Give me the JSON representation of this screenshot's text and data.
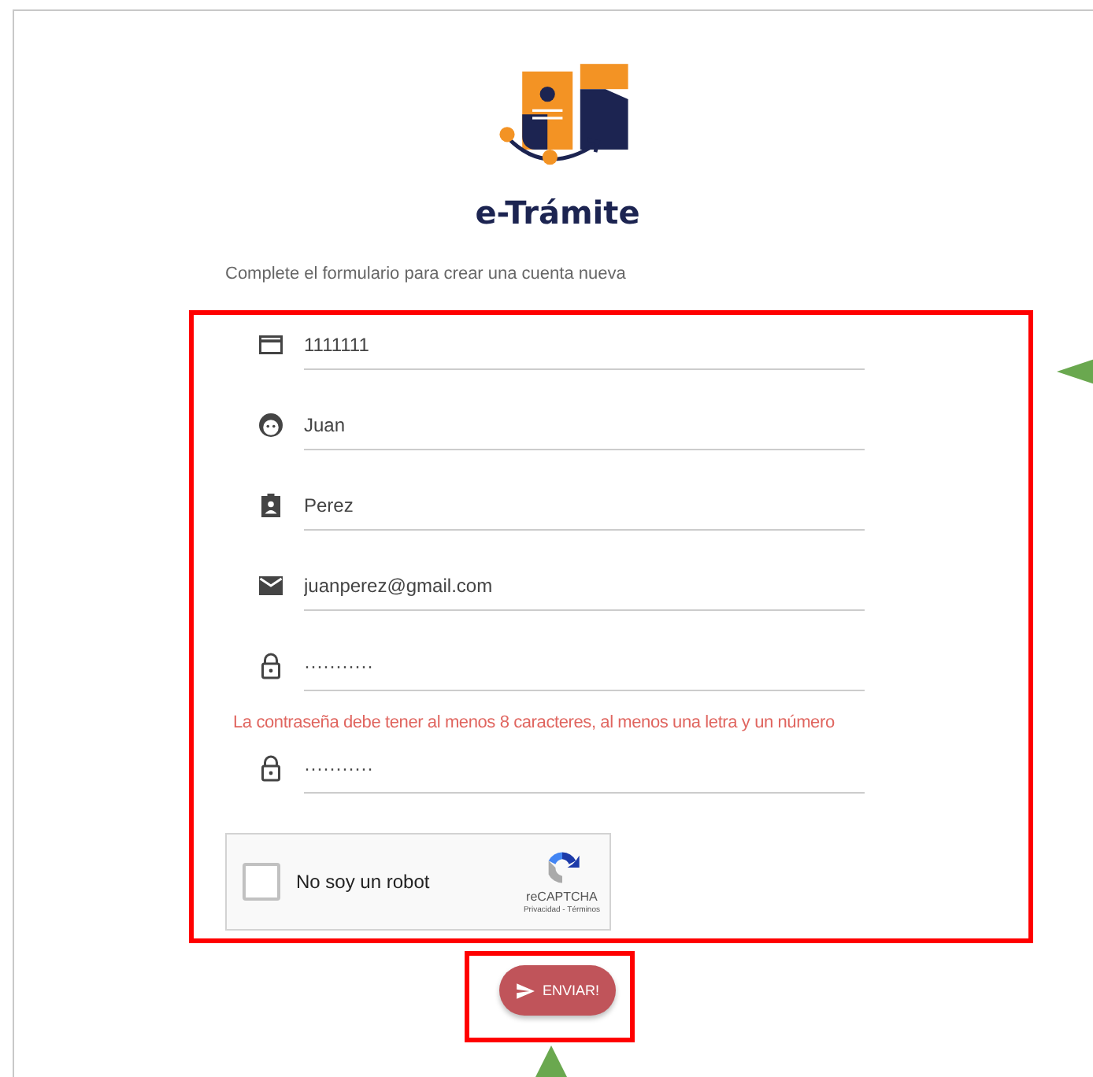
{
  "logo": {
    "name": "e-Trámite"
  },
  "intro": "Complete el formulario para crear una cuenta nueva",
  "fields": [
    {
      "kind": "card",
      "value": "1111111"
    },
    {
      "kind": "face",
      "value": "Juan"
    },
    {
      "kind": "badge",
      "value": "Perez"
    },
    {
      "kind": "mail",
      "value": "juanperez@gmail.com"
    },
    {
      "kind": "lock",
      "value": "···········",
      "error": "La contraseña debe tener al menos 8 caracteres, al menos una letra y un número"
    },
    {
      "kind": "lock",
      "value": "···········"
    }
  ],
  "captcha": {
    "label": "No soy un robot",
    "checked": false,
    "brand": "reCAPTCHA",
    "links": "Privacidad - Términos"
  },
  "submit": {
    "label": "ENVIAR!"
  },
  "annotations": [
    {
      "kind": "frame"
    },
    {
      "kind": "frame"
    },
    {
      "kind": "arrow"
    },
    {
      "kind": "arrow"
    }
  ]
}
